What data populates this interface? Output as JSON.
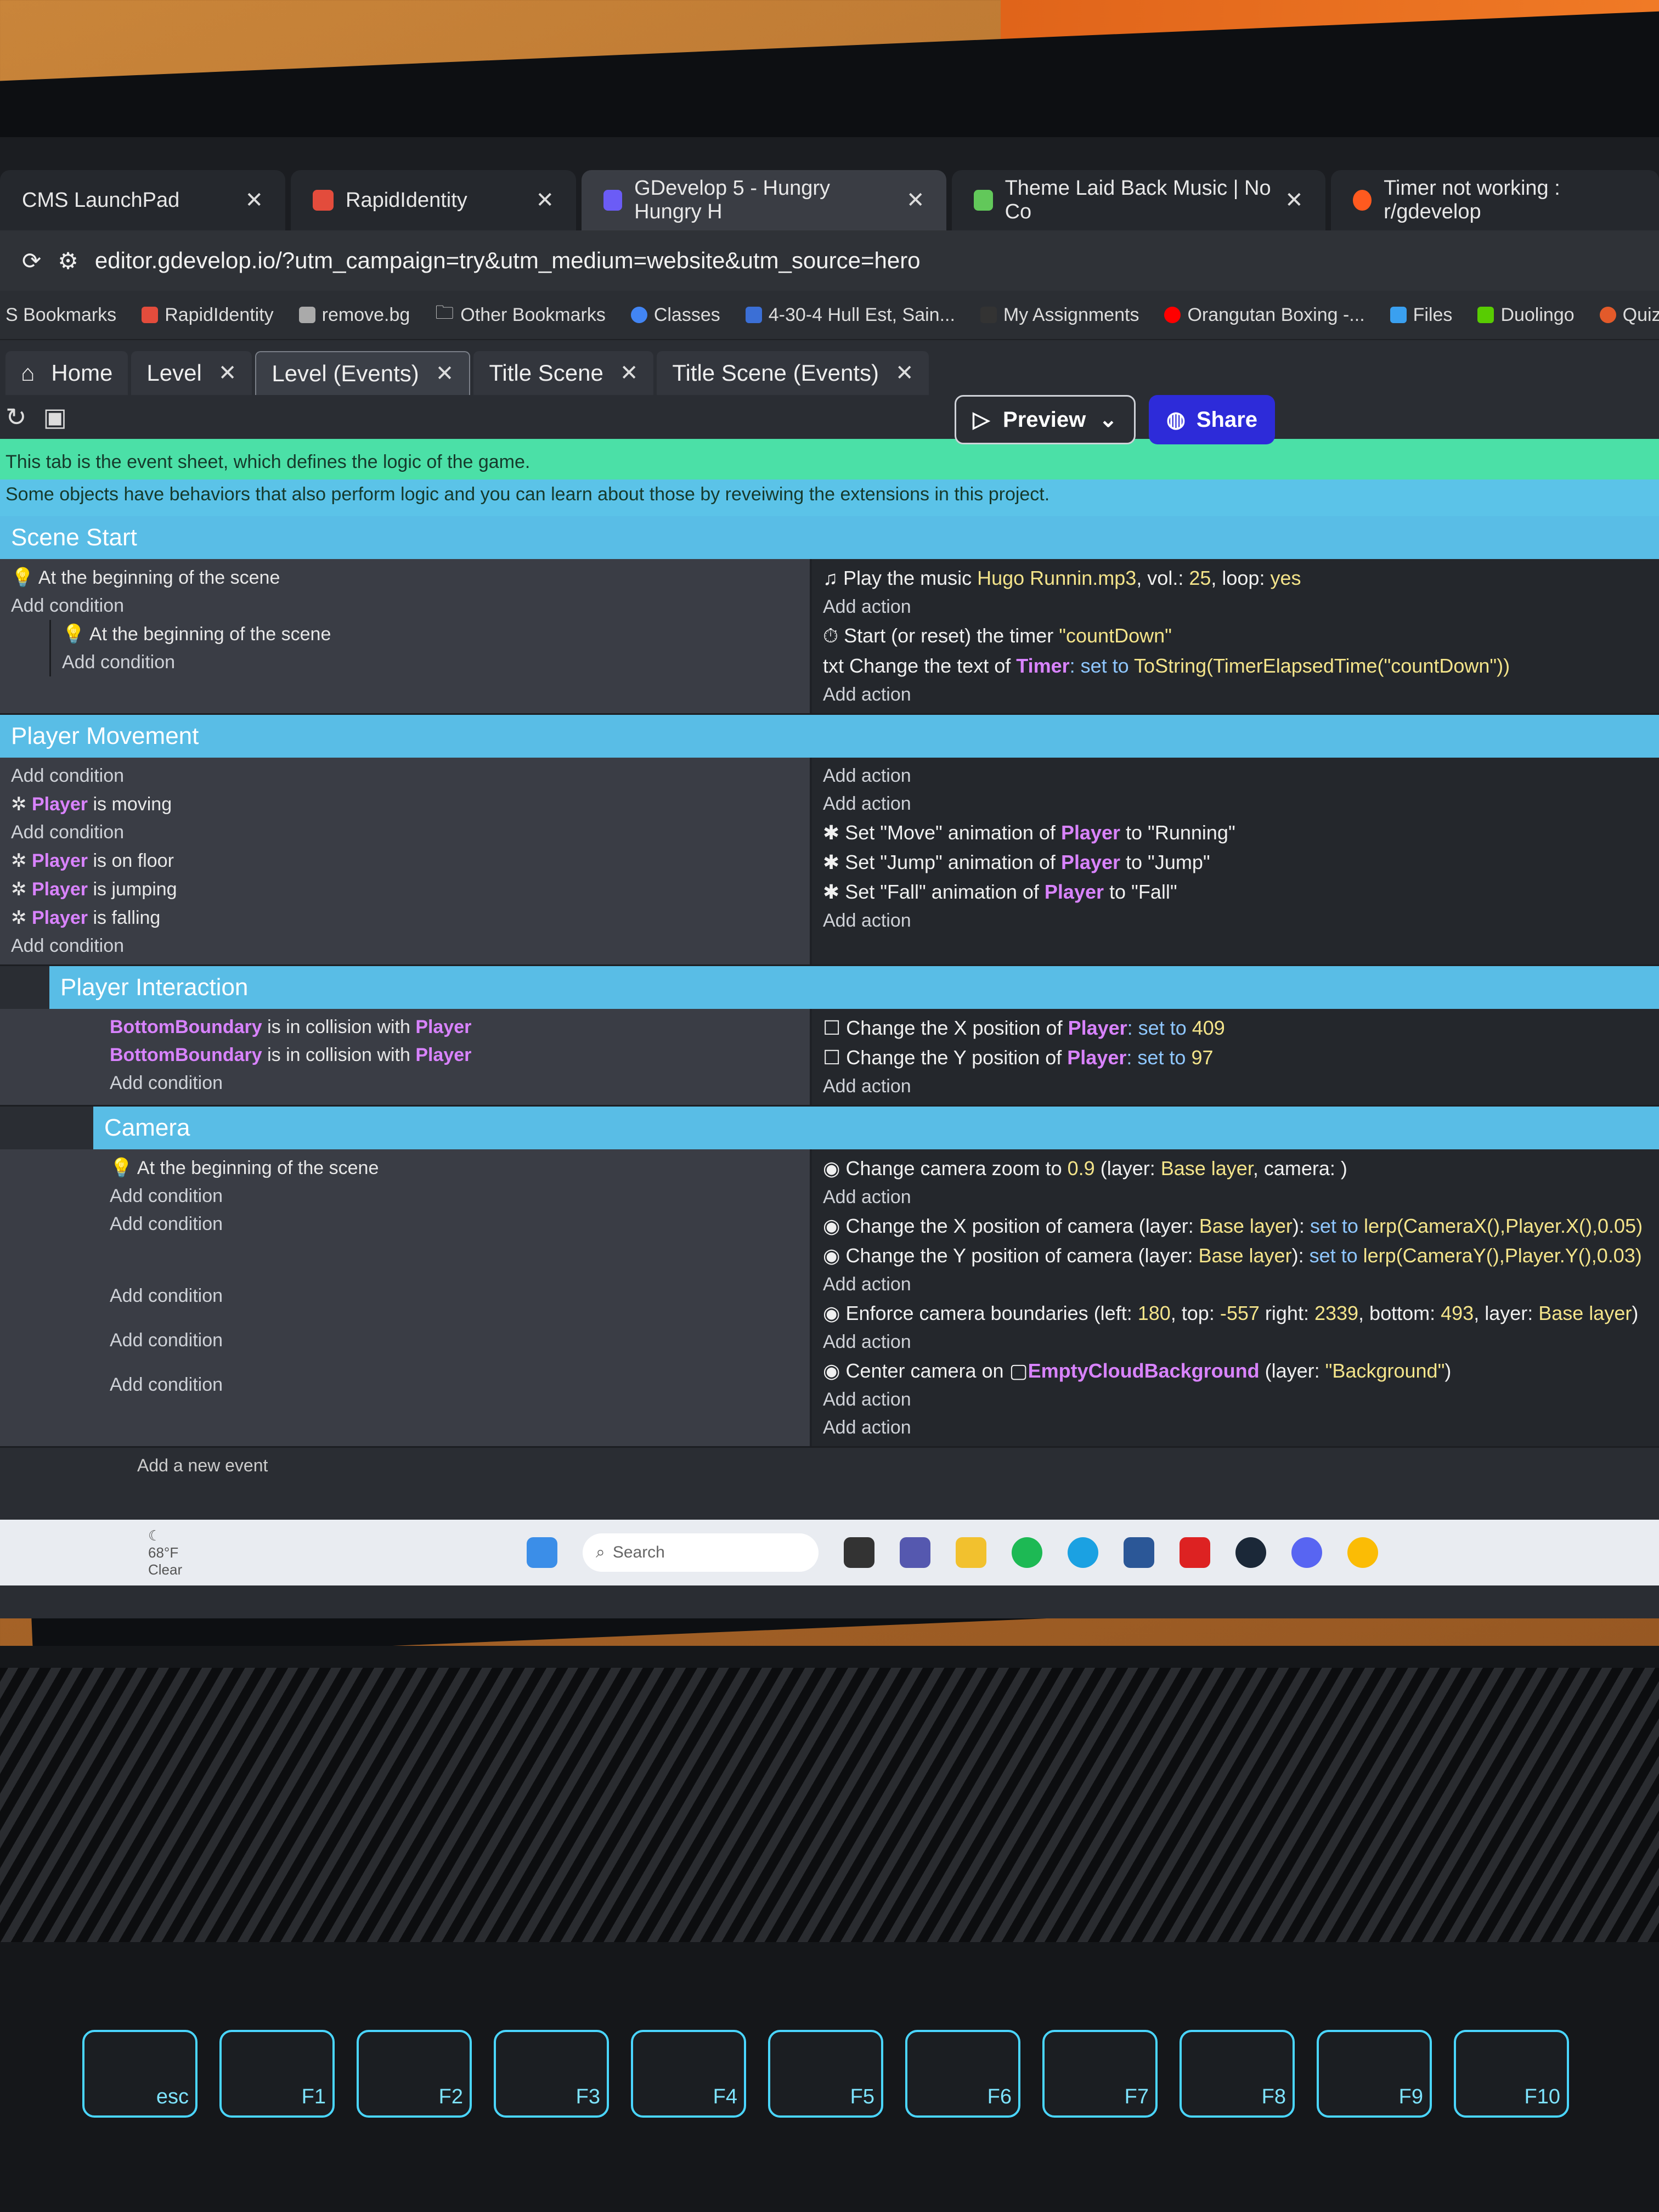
{
  "browser": {
    "tabs": [
      {
        "label": "CMS LaunchPad"
      },
      {
        "label": "RapidIdentity"
      },
      {
        "label": "GDevelop 5 - Hungry Hungry H"
      },
      {
        "label": "Theme Laid Back Music | No Co"
      },
      {
        "label": "Timer not working : r/gdevelop"
      }
    ],
    "url": "editor.gdevelop.io/?utm_campaign=try&utm_medium=website&utm_source=hero",
    "bookmarks": [
      "S Bookmarks",
      "RapidIdentity",
      "remove.bg",
      "Other Bookmarks",
      "Classes",
      "4-30-4 Hull Est, Sain...",
      "My Assignments",
      "Orangutan Boxing -...",
      "Files",
      "Duolingo",
      "Quizzes"
    ]
  },
  "editor": {
    "tabs": [
      {
        "label": "Home"
      },
      {
        "label": "Level"
      },
      {
        "label": "Level (Events)"
      },
      {
        "label": "Title Scene"
      },
      {
        "label": "Title Scene (Events)"
      }
    ],
    "preview_label": "Preview",
    "share_label": "Share",
    "comment_line1": "This tab is the event sheet, which defines the logic of the game.",
    "comment_line2": "Some objects have behaviors that also perform logic and you can learn about those by reveiwing the extensions in this project.",
    "add_condition": "Add condition",
    "add_action": "Add action",
    "add_event": "Add a new event"
  },
  "groups": {
    "scene_start": "Scene Start",
    "player_movement": "Player Movement",
    "player_interaction": "Player Interaction",
    "camera": "Camera"
  },
  "scene_start": {
    "cond1": "At the beginning of the scene",
    "cond2": "At the beginning of the scene",
    "act1_pre": "Play the music ",
    "act1_file": "Hugo Runnin.mp3",
    "act1_mid": ", vol.: ",
    "act1_vol": "25",
    "act1_mid2": ", loop: ",
    "act1_loop": "yes",
    "act2_pre": "Start (or reset) the timer ",
    "act2_timer": "\"countDown\"",
    "act3_pre": "Change the text of ",
    "act3_obj": "Timer",
    "act3_mid": ": set to ",
    "act3_expr": "ToString(TimerElapsedTime(\"countDown\"))"
  },
  "player_movement": {
    "moving": "is moving",
    "on_floor": "is on floor",
    "jumping": "is jumping",
    "falling": "is falling",
    "player": "Player",
    "anim1_pre": "Set \"Move\" animation of ",
    "anim1_post": " to \"Running\"",
    "anim2_pre": "Set \"Jump\" animation of ",
    "anim2_post": " to \"Jump\"",
    "anim3_pre": "Set \"Fall\" animation of ",
    "anim3_post": " to \"Fall\""
  },
  "player_interaction": {
    "boundary": "BottomBoundary",
    "collision": " is in collision with ",
    "player": "Player",
    "actx_pre": "Change the X position of ",
    "actx_mid": ": set to ",
    "actx_val": "409",
    "acty_pre": "Change the Y position of ",
    "acty_mid": ": set to ",
    "acty_val": "97"
  },
  "camera": {
    "cond1": "At the beginning of the scene",
    "zoom_pre": "Change camera zoom to ",
    "zoom_val": "0.9",
    "zoom_post": " (layer: ",
    "zoom_layer": "Base layer",
    "zoom_end": ", camera: )",
    "camx_pre": "Change the X position of camera (layer: ",
    "camx_layer": "Base layer",
    "camx_mid": "): ",
    "camx_set": "set to",
    "camx_expr": " lerp(CameraX(),Player.X(),0.05)",
    "camy_pre": "Change the Y position of camera (layer: ",
    "camy_layer": "Base layer",
    "camy_mid": "): ",
    "camy_set": "set to",
    "camy_expr": " lerp(CameraY(),Player.Y(),0.03)",
    "bounds_pre": "Enforce camera boundaries (left: ",
    "bounds_left": "180",
    "bounds_top_l": ", top: ",
    "bounds_top": "-557",
    "bounds_right_l": " right: ",
    "bounds_right": "2339",
    "bounds_bottom_l": ", bottom: ",
    "bounds_bottom": "493",
    "bounds_layer_l": ", layer: ",
    "bounds_layer": "Base layer",
    "bounds_end": ")",
    "center_pre": "Center camera on ",
    "center_obj": "EmptyCloudBackground",
    "center_post": " (layer: ",
    "center_layer": "\"Background\"",
    "center_end": ")"
  },
  "taskbar": {
    "temp": "68°F",
    "cond": "Clear",
    "search": "Search"
  },
  "keyboard": {
    "keys": [
      "esc",
      "F1",
      "F2",
      "F3",
      "F4",
      "F5",
      "F6",
      "F7",
      "F8",
      "F9",
      "F10"
    ]
  }
}
